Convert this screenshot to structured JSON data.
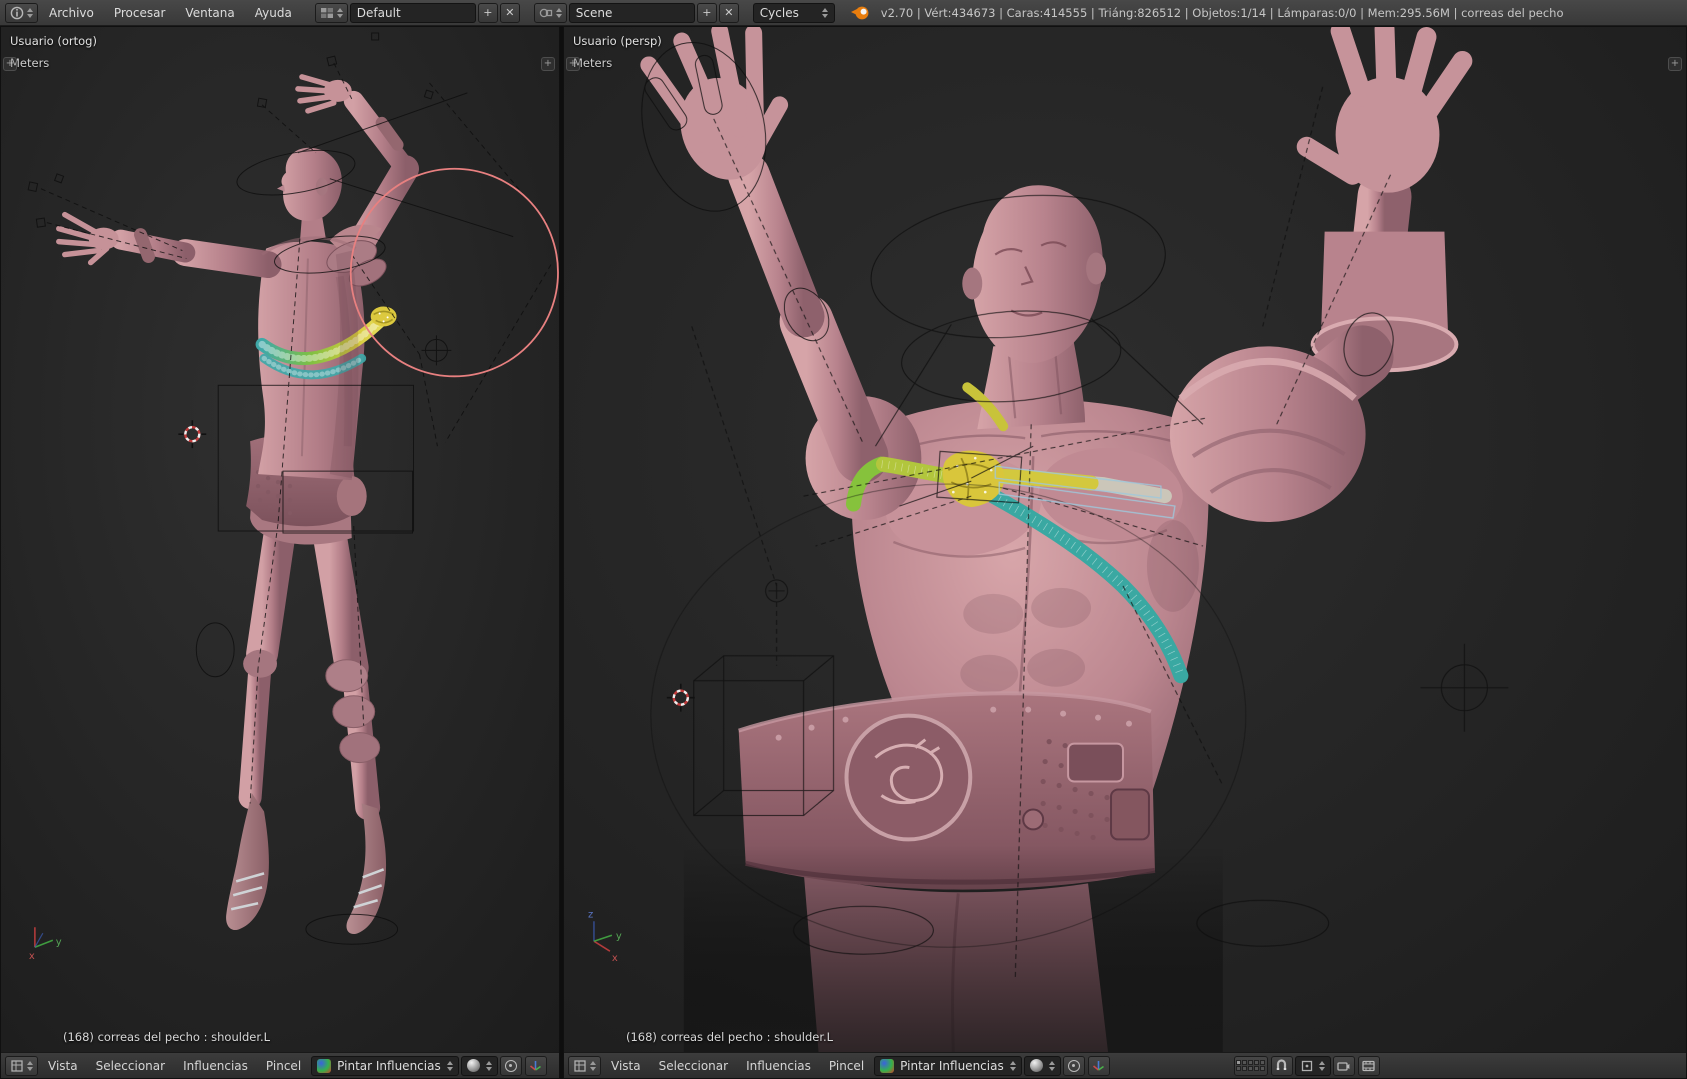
{
  "colors": {
    "header_bg": "#3c3c3c",
    "viewport_bg": "#232323",
    "model_pink": "#c08388",
    "strap_yellow": "#d8ca3c",
    "strap_green": "#7fc043",
    "strap_teal": "#3fa8a8",
    "brush_red": "#e88080"
  },
  "icons": {
    "plus": "+",
    "close": "✕"
  },
  "top_header": {
    "menus": [
      {
        "label": "Archivo"
      },
      {
        "label": "Procesar"
      },
      {
        "label": "Ventana"
      },
      {
        "label": "Ayuda"
      }
    ],
    "layout": {
      "value": "Default"
    },
    "scene": {
      "value": "Scene"
    },
    "engine": {
      "value": "Cycles"
    },
    "stats": "v2.70 | Vért:434673 | Caras:414555 | Triáng:826512 | Objetos:1/14 | Lámparas:0/0 | Mem:295.56M | correas del pecho"
  },
  "viewports": {
    "left": {
      "view_label": "Usuario (ortog)",
      "unit": "Meters",
      "status": "(168) correas del pecho : shoulder.L"
    },
    "right": {
      "view_label": "Usuario (persp)",
      "unit": "Meters",
      "status": "(168) correas del pecho : shoulder.L"
    }
  },
  "viewport_header": {
    "menus": [
      {
        "label": "Vista"
      },
      {
        "label": "Seleccionar"
      },
      {
        "label": "Influencias"
      },
      {
        "label": "Pincel"
      }
    ],
    "mode": {
      "label": "Pintar Influencias"
    }
  },
  "axis": {
    "x": "x",
    "y": "y",
    "z": "z"
  }
}
